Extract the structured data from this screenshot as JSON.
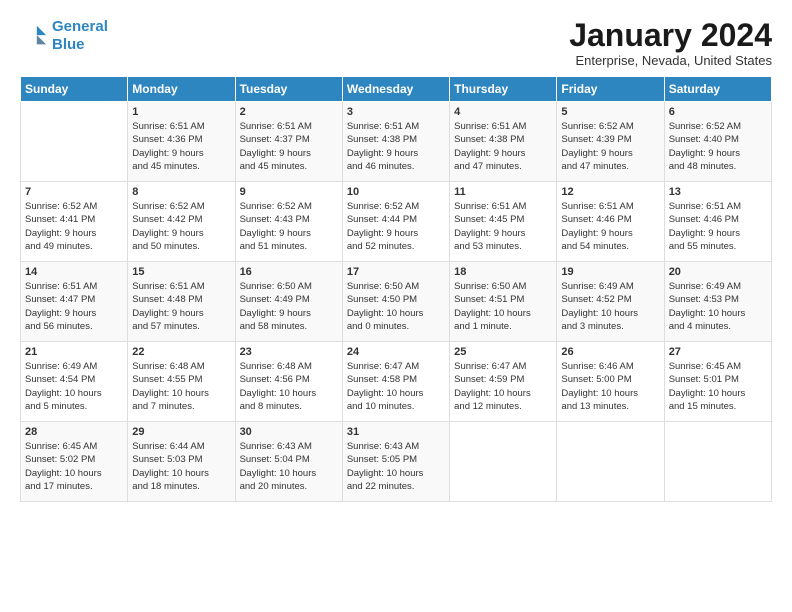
{
  "logo": {
    "line1": "General",
    "line2": "Blue"
  },
  "title": "January 2024",
  "subtitle": "Enterprise, Nevada, United States",
  "days_header": [
    "Sunday",
    "Monday",
    "Tuesday",
    "Wednesday",
    "Thursday",
    "Friday",
    "Saturday"
  ],
  "weeks": [
    [
      {
        "day": "",
        "info": ""
      },
      {
        "day": "1",
        "info": "Sunrise: 6:51 AM\nSunset: 4:36 PM\nDaylight: 9 hours\nand 45 minutes."
      },
      {
        "day": "2",
        "info": "Sunrise: 6:51 AM\nSunset: 4:37 PM\nDaylight: 9 hours\nand 45 minutes."
      },
      {
        "day": "3",
        "info": "Sunrise: 6:51 AM\nSunset: 4:38 PM\nDaylight: 9 hours\nand 46 minutes."
      },
      {
        "day": "4",
        "info": "Sunrise: 6:51 AM\nSunset: 4:38 PM\nDaylight: 9 hours\nand 47 minutes."
      },
      {
        "day": "5",
        "info": "Sunrise: 6:52 AM\nSunset: 4:39 PM\nDaylight: 9 hours\nand 47 minutes."
      },
      {
        "day": "6",
        "info": "Sunrise: 6:52 AM\nSunset: 4:40 PM\nDaylight: 9 hours\nand 48 minutes."
      }
    ],
    [
      {
        "day": "7",
        "info": "Sunrise: 6:52 AM\nSunset: 4:41 PM\nDaylight: 9 hours\nand 49 minutes."
      },
      {
        "day": "8",
        "info": "Sunrise: 6:52 AM\nSunset: 4:42 PM\nDaylight: 9 hours\nand 50 minutes."
      },
      {
        "day": "9",
        "info": "Sunrise: 6:52 AM\nSunset: 4:43 PM\nDaylight: 9 hours\nand 51 minutes."
      },
      {
        "day": "10",
        "info": "Sunrise: 6:52 AM\nSunset: 4:44 PM\nDaylight: 9 hours\nand 52 minutes."
      },
      {
        "day": "11",
        "info": "Sunrise: 6:51 AM\nSunset: 4:45 PM\nDaylight: 9 hours\nand 53 minutes."
      },
      {
        "day": "12",
        "info": "Sunrise: 6:51 AM\nSunset: 4:46 PM\nDaylight: 9 hours\nand 54 minutes."
      },
      {
        "day": "13",
        "info": "Sunrise: 6:51 AM\nSunset: 4:46 PM\nDaylight: 9 hours\nand 55 minutes."
      }
    ],
    [
      {
        "day": "14",
        "info": "Sunrise: 6:51 AM\nSunset: 4:47 PM\nDaylight: 9 hours\nand 56 minutes."
      },
      {
        "day": "15",
        "info": "Sunrise: 6:51 AM\nSunset: 4:48 PM\nDaylight: 9 hours\nand 57 minutes."
      },
      {
        "day": "16",
        "info": "Sunrise: 6:50 AM\nSunset: 4:49 PM\nDaylight: 9 hours\nand 58 minutes."
      },
      {
        "day": "17",
        "info": "Sunrise: 6:50 AM\nSunset: 4:50 PM\nDaylight: 10 hours\nand 0 minutes."
      },
      {
        "day": "18",
        "info": "Sunrise: 6:50 AM\nSunset: 4:51 PM\nDaylight: 10 hours\nand 1 minute."
      },
      {
        "day": "19",
        "info": "Sunrise: 6:49 AM\nSunset: 4:52 PM\nDaylight: 10 hours\nand 3 minutes."
      },
      {
        "day": "20",
        "info": "Sunrise: 6:49 AM\nSunset: 4:53 PM\nDaylight: 10 hours\nand 4 minutes."
      }
    ],
    [
      {
        "day": "21",
        "info": "Sunrise: 6:49 AM\nSunset: 4:54 PM\nDaylight: 10 hours\nand 5 minutes."
      },
      {
        "day": "22",
        "info": "Sunrise: 6:48 AM\nSunset: 4:55 PM\nDaylight: 10 hours\nand 7 minutes."
      },
      {
        "day": "23",
        "info": "Sunrise: 6:48 AM\nSunset: 4:56 PM\nDaylight: 10 hours\nand 8 minutes."
      },
      {
        "day": "24",
        "info": "Sunrise: 6:47 AM\nSunset: 4:58 PM\nDaylight: 10 hours\nand 10 minutes."
      },
      {
        "day": "25",
        "info": "Sunrise: 6:47 AM\nSunset: 4:59 PM\nDaylight: 10 hours\nand 12 minutes."
      },
      {
        "day": "26",
        "info": "Sunrise: 6:46 AM\nSunset: 5:00 PM\nDaylight: 10 hours\nand 13 minutes."
      },
      {
        "day": "27",
        "info": "Sunrise: 6:45 AM\nSunset: 5:01 PM\nDaylight: 10 hours\nand 15 minutes."
      }
    ],
    [
      {
        "day": "28",
        "info": "Sunrise: 6:45 AM\nSunset: 5:02 PM\nDaylight: 10 hours\nand 17 minutes."
      },
      {
        "day": "29",
        "info": "Sunrise: 6:44 AM\nSunset: 5:03 PM\nDaylight: 10 hours\nand 18 minutes."
      },
      {
        "day": "30",
        "info": "Sunrise: 6:43 AM\nSunset: 5:04 PM\nDaylight: 10 hours\nand 20 minutes."
      },
      {
        "day": "31",
        "info": "Sunrise: 6:43 AM\nSunset: 5:05 PM\nDaylight: 10 hours\nand 22 minutes."
      },
      {
        "day": "",
        "info": ""
      },
      {
        "day": "",
        "info": ""
      },
      {
        "day": "",
        "info": ""
      }
    ]
  ]
}
